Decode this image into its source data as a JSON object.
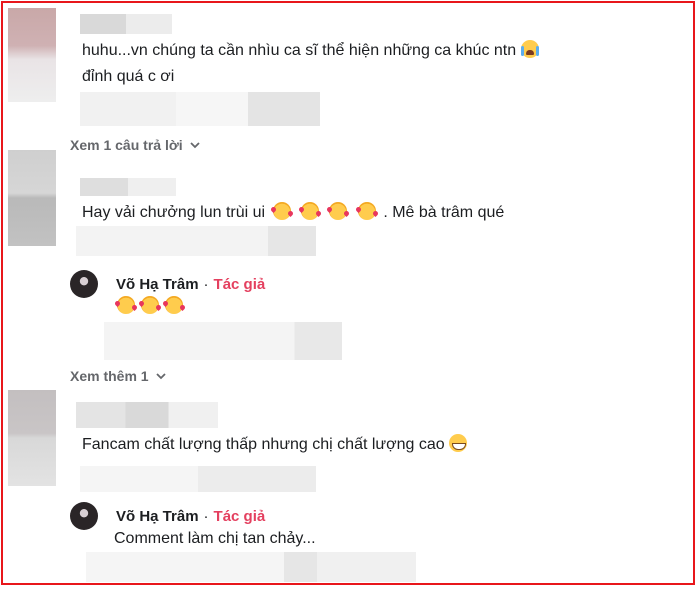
{
  "comments": [
    {
      "text": "huhu...vn chúng ta cần nhìu ca sĩ thể hiện những ca khúc ntn",
      "text_line2": "đỉnh quá c ơi",
      "emoji": "loudly-crying-face"
    },
    {
      "text": "Hay vải chưởng lun trùi ui",
      "text_suffix": ". Mê bà trâm qué",
      "emoji": "smiling-face-with-hearts"
    },
    {
      "text": "Fancam chất lượng thấp nhưng chị chất lượng cao",
      "emoji": "grinning-face"
    }
  ],
  "replies_toggle": [
    {
      "label": "Xem 1 câu trả lời"
    },
    {
      "label": "Xem thêm 1"
    }
  ],
  "author_replies": [
    {
      "name": "Võ Hạ Trâm",
      "badge": "Tác giả",
      "separator": "·",
      "emoji": "smiling-face-with-hearts"
    },
    {
      "name": "Võ Hạ Trâm",
      "badge": "Tác giả",
      "separator": "·",
      "text": "Comment làm chị tan chảy..."
    }
  ],
  "colors": {
    "highlight_border": "#e8161b",
    "author_badge": "#e4405f",
    "muted": "#65676b"
  }
}
